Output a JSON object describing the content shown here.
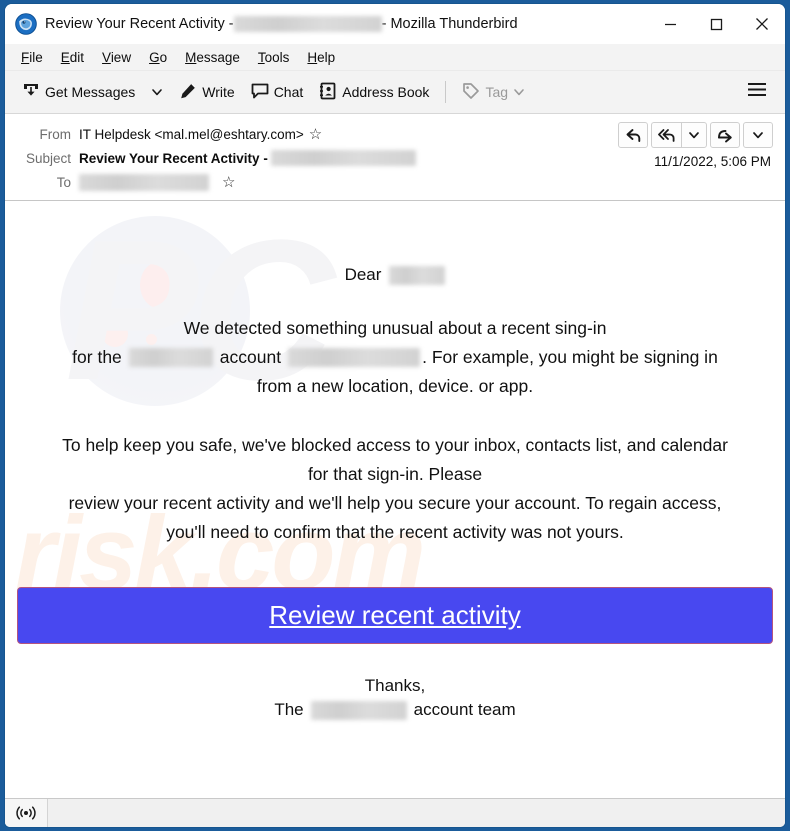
{
  "window": {
    "app_name": "Mozilla Thunderbird",
    "title_prefix": "Review Your Recent Activity - ",
    "title_suffix": " - Mozilla Thunderbird",
    "border_color": "#1b5c9b",
    "controls": {
      "minimize": "–",
      "maximize": "☐",
      "close": "✕"
    }
  },
  "menubar": {
    "items": [
      {
        "label": "File",
        "accesskey": "F"
      },
      {
        "label": "Edit",
        "accesskey": "E"
      },
      {
        "label": "View",
        "accesskey": "V"
      },
      {
        "label": "Go",
        "accesskey": "G"
      },
      {
        "label": "Message",
        "accesskey": "M"
      },
      {
        "label": "Tools",
        "accesskey": "T"
      },
      {
        "label": "Help",
        "accesskey": "H"
      }
    ]
  },
  "toolbar": {
    "get_messages": "Get Messages",
    "write": "Write",
    "chat": "Chat",
    "address_book": "Address Book",
    "tag": "Tag",
    "tag_disabled": true,
    "app_menu_icon": "hamburger-icon"
  },
  "message_header": {
    "from_label": "From",
    "from_value": "IT Helpdesk <mal.mel@eshtary.com>",
    "subject_label": "Subject",
    "subject_value": "Review Your Recent Activity - ",
    "to_label": "To",
    "to_value": "",
    "datetime": "11/1/2022, 5:06 PM",
    "star_glyph": "☆",
    "reply_buttons": [
      {
        "name": "reply-button",
        "icon": "reply-arrow-icon"
      },
      {
        "name": "reply-all-button",
        "icon": "reply-all-arrow-icon"
      },
      {
        "name": "reply-dropdown-button",
        "icon": "chevron-down-icon"
      },
      {
        "name": "forward-button",
        "icon": "forward-arrow-icon"
      },
      {
        "name": "more-dropdown-button",
        "icon": "chevron-down-icon"
      }
    ]
  },
  "body": {
    "greeting": "Dear",
    "paragraph1_line1": "We detected something unusual about a recent sing-in",
    "paragraph1_line2_a": "for the",
    "paragraph1_line2_b": "account",
    "paragraph1_line2_c": ". For example, you might be signing in",
    "paragraph1_line3": "from a new location, device. or app.",
    "paragraph2_line1": "To help keep you safe, we've blocked access to your inbox, contacts list, and calendar",
    "paragraph2_line2": "for that sign-in. Please",
    "paragraph2_line3": "review your recent activity and we'll help you secure your account. To regain access,",
    "paragraph2_line4": "you'll need to confirm that the recent activity was not yours.",
    "cta_label": "Review recent activity",
    "cta_color": "#4848f0",
    "cta_border_color": "#b4557f",
    "thanks": "Thanks,",
    "signature_a": "The",
    "signature_b": "account team",
    "watermark_primary": "PC",
    "watermark_secondary": "risk.com"
  },
  "statusbar": {
    "icon": "broadcast-icon"
  }
}
